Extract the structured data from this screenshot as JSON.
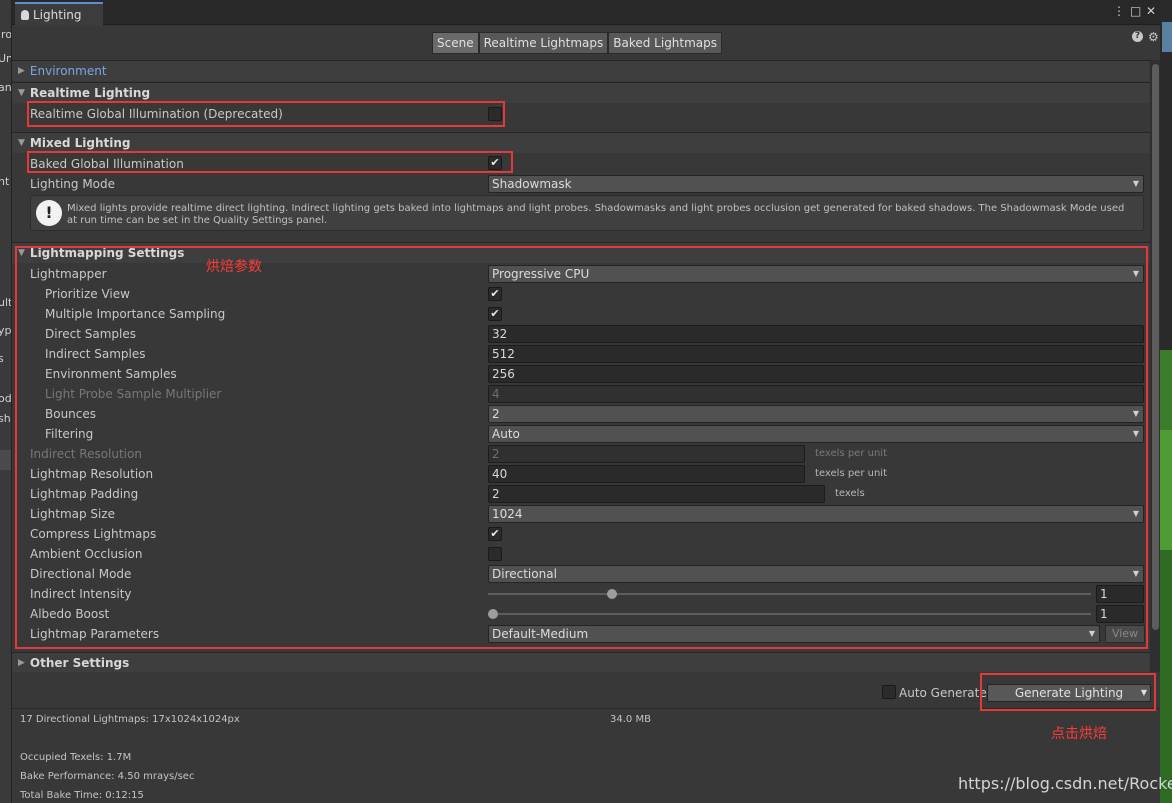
{
  "side_left": {
    "fragments": [
      "iro",
      "Un",
      "an",
      "ht",
      "ult",
      "yp",
      "s",
      "od",
      "sh"
    ]
  },
  "window": {
    "tab_title": "Lighting",
    "menu_glyph": "⋮",
    "maximize_glyph": "□",
    "close_glyph": "✕"
  },
  "modes": {
    "scene": "Scene",
    "realtime": "Realtime Lightmaps",
    "baked": "Baked Lightmaps"
  },
  "sections": {
    "environment": "Environment",
    "realtime": "Realtime Lighting",
    "mixed": "Mixed Lighting",
    "lightmapping": "Lightmapping Settings",
    "other": "Other Settings"
  },
  "realtime": {
    "gi_label": "Realtime Global Illumination (Deprecated)",
    "gi_checked": false
  },
  "mixed": {
    "baked_gi_label": "Baked Global Illumination",
    "baked_gi_checked": true,
    "mode_label": "Lighting Mode",
    "mode_value": "Shadowmask",
    "info": "Mixed lights provide realtime direct lighting. Indirect lighting gets baked into lightmaps and light probes. Shadowmasks and light probes occlusion get generated for baked shadows. The Shadowmask Mode used at run time can be set in the Quality Settings panel."
  },
  "lightmapping": {
    "lightmapper": {
      "label": "Lightmapper",
      "value": "Progressive CPU"
    },
    "prioritize_view": {
      "label": "Prioritize View",
      "checked": true
    },
    "mis": {
      "label": "Multiple Importance Sampling",
      "checked": true
    },
    "direct_samples": {
      "label": "Direct Samples",
      "value": "32"
    },
    "indirect_samples": {
      "label": "Indirect Samples",
      "value": "512"
    },
    "environment_samples": {
      "label": "Environment Samples",
      "value": "256"
    },
    "probe_multiplier": {
      "label": "Light Probe Sample Multiplier",
      "value": "4"
    },
    "bounces": {
      "label": "Bounces",
      "value": "2"
    },
    "filtering": {
      "label": "Filtering",
      "value": "Auto"
    },
    "indirect_resolution": {
      "label": "Indirect Resolution",
      "value": "2",
      "unit": "texels per unit"
    },
    "lightmap_resolution": {
      "label": "Lightmap Resolution",
      "value": "40",
      "unit": "texels per unit"
    },
    "lightmap_padding": {
      "label": "Lightmap Padding",
      "value": "2",
      "unit": "texels"
    },
    "lightmap_size": {
      "label": "Lightmap Size",
      "value": "1024"
    },
    "compress": {
      "label": "Compress Lightmaps",
      "checked": true
    },
    "ambient_occlusion": {
      "label": "Ambient Occlusion",
      "checked": false
    },
    "directional_mode": {
      "label": "Directional Mode",
      "value": "Directional"
    },
    "indirect_intensity": {
      "label": "Indirect Intensity",
      "value": "1"
    },
    "albedo_boost": {
      "label": "Albedo Boost",
      "value": "1"
    },
    "parameters": {
      "label": "Lightmap Parameters",
      "value": "Default-Medium",
      "view": "View"
    }
  },
  "generate": {
    "auto_label": "Auto Generate",
    "auto_checked": false,
    "button": "Generate Lighting"
  },
  "stats": {
    "lightmaps": "17 Directional Lightmaps: 17x1024x1024px",
    "size": "34.0 MB",
    "texels": "Occupied Texels: 1.7M",
    "performance": "Bake Performance: 4.50 mrays/sec",
    "time": "Total Bake Time: 0:12:15"
  },
  "annotations": {
    "bake_params": "烘焙参数",
    "click_bake": "点击烘焙",
    "accent_color": "#e23a3a"
  },
  "watermark": "https://blog.csdn.net/RocketJ"
}
